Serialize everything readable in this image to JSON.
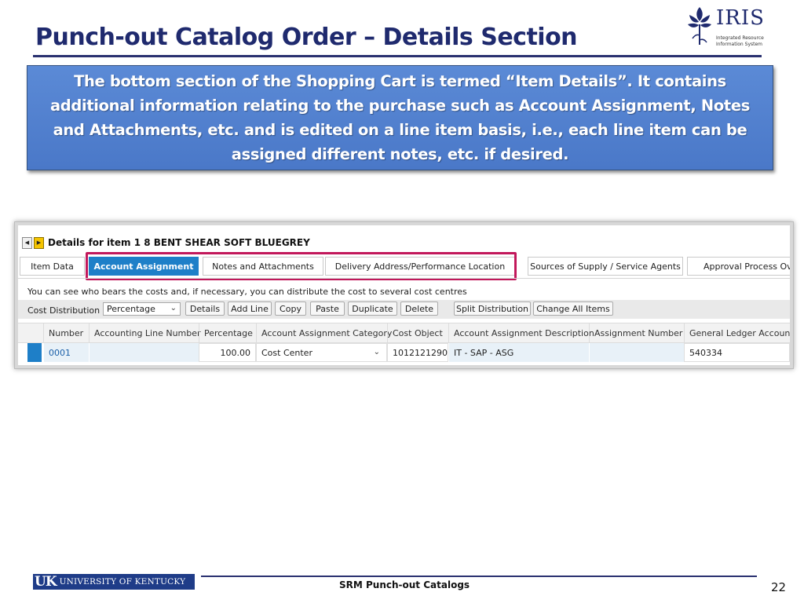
{
  "slide": {
    "title": "Punch-out Catalog Order – Details Section",
    "callout": "The bottom section of the Shopping Cart is termed “Item Details”. It contains additional information relating to the purchase such as Account Assignment, Notes and Attachments, etc. and is edited on a line item basis, i.e., each line item can be assigned different notes, etc. if desired.",
    "footer_text": "SRM Punch-out Catalogs",
    "page_number": "22"
  },
  "logos": {
    "iris": {
      "word": "IRIS",
      "sub1": "Integrated Resource",
      "sub2": "Information System"
    },
    "uk": {
      "short": "UK",
      "name": "UNIVERSITY OF KENTUCKY"
    }
  },
  "sap": {
    "details_title": "Details for item 1  8  BENT SHEAR SOFT BLUEGREY",
    "tabs": [
      {
        "label": "Item Data",
        "active": false
      },
      {
        "label": "Account Assignment",
        "active": true
      },
      {
        "label": "Notes and Attachments",
        "active": false
      },
      {
        "label": "Delivery Address/Performance Location",
        "active": false
      },
      {
        "label": "Sources of Supply / Service Agents",
        "active": false
      },
      {
        "label": "Approval Process Overv",
        "active": false
      }
    ],
    "info_text": "You can see who bears the costs and, if necessary, you can distribute the cost to several cost centres",
    "cost_distribution_label": "Cost Distribution",
    "cost_distribution_value": "Percentage",
    "toolbar_buttons": [
      "Details",
      "Add Line",
      "Copy",
      "Paste",
      "Duplicate",
      "Delete",
      "Split Distribution",
      "Change All Items"
    ],
    "columns": [
      "Number",
      "Accounting Line Number",
      "Percentage",
      "Account Assignment Category",
      "Cost Object",
      "Account Assignment Description",
      "Assignment Number",
      "General Ledger Account"
    ],
    "row": {
      "number": "0001",
      "accounting_line_number": "",
      "percentage": "100.00",
      "category": "Cost Center",
      "cost_object": "1012121290",
      "description": "IT - SAP - ASG",
      "assignment_number": "",
      "gl_account": "540334"
    },
    "colors": {
      "accent": "#1e7fc8",
      "highlight": "#c2185b",
      "callout": "#4f7fcf"
    }
  }
}
